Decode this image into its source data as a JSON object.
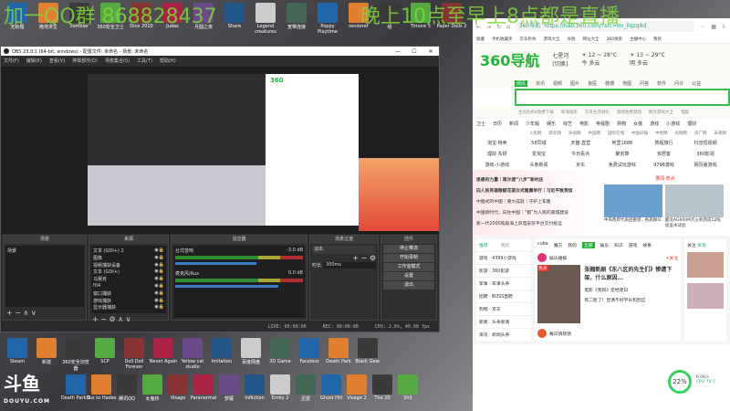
{
  "overlay": {
    "left": "加一QQ群 868828437",
    "right": "晚上10点至早上8点都是直播"
  },
  "desktop_top": [
    "无标题",
    "绝地求生",
    "zombier",
    "360安全卫士",
    "Dice 2010",
    "Judas",
    "月圆之夜",
    "Share",
    "Legend creatures",
    "宽带连接",
    "Poppy Playtime",
    "renderer",
    "组",
    "Timore 5",
    "Paper Dolls 2"
  ],
  "desktop_bottom1": [
    "Steam",
    "新建",
    "360安全浏览器",
    "SCP",
    "Doll Doll Forever",
    "Never Again",
    "Yellow cat studio",
    "Imitation",
    "百度网盘",
    "3D Game",
    "Faceless",
    "Death Park",
    "Black Gear"
  ],
  "desktop_bottom2": [
    "Death Park 2",
    "Bus to Hades",
    "腾讯QQ",
    "女鬼桥",
    "Visage",
    "Paranormal",
    "梦魇",
    "Infliction",
    "Emily 2",
    "迅雷",
    "Ghost Hill",
    "Visage 2",
    "The 20",
    "Sh5"
  ],
  "obs": {
    "title": "OBS 23.0.1 (64-bit, windows) - 配置文件: 未命名 - 场景: 未命名",
    "menu": [
      "文件(F)",
      "编辑(E)",
      "查看(V)",
      "停靠部件(D)",
      "场景集合(S)",
      "工具(T)",
      "帮助(H)"
    ],
    "docks": {
      "scenes": "场景",
      "sources": "来源",
      "mixer": "混音器",
      "transitions": "场景过渡",
      "controls": "控件"
    },
    "scenes": [
      "场景"
    ],
    "sources": [
      "文本 (GDI+) 2",
      "图像",
      "视频捕获设备",
      "文本 (GDI+)",
      "马赛克",
      "f04",
      "窗口捕获",
      "游戏捕获",
      "显示器捕获"
    ],
    "mixer": [
      {
        "name": "台式音响",
        "db": "-3.0 dB",
        "level": 0.75
      },
      {
        "name": "麦克风/Aux",
        "db": "0.0 dB",
        "level": 0.95
      }
    ],
    "transition": {
      "type": "淡出",
      "duration_label": "时长",
      "duration": "300ms"
    },
    "controls": [
      "停止推流",
      "开始录制",
      "工作室模式",
      "设置",
      "退出"
    ],
    "status": {
      "live": "LIVE: 00:00:00",
      "rec": "REC: 00:00:00",
      "cpu": "CPU: 2.6%, 40.00 fps"
    }
  },
  "browser": {
    "url": "https://hao.360.com/?src=lm_llqzq8d",
    "site_tag": "360导航",
    "bookmarks": [
      "收藏",
      "手机收藏夹",
      "京东秒杀",
      "游戏大全",
      "谷歌",
      "网址大全",
      "360搜索",
      "主播中心",
      "我的"
    ],
    "logo": "360导航",
    "city": "七星河",
    "city_sub": "[切换]",
    "weather": [
      {
        "temp": "12 ~ 28°C",
        "day": "今",
        "desc": "多云"
      },
      {
        "temp": "13 ~ 29°C",
        "day": "明",
        "desc": "多云"
      }
    ],
    "search_tabs": [
      "网页",
      "资讯",
      "视频",
      "图片",
      "良医",
      "微博",
      "地图",
      "问答",
      "软件",
      "问诊",
      "公益"
    ],
    "hot": [
      "生化危机4免费下载",
      "探海迷航",
      "方舟生存进化",
      "游戏免费游戏",
      "网页游戏大全",
      "电脑"
    ],
    "nav": [
      "卫士",
      "日历",
      "新闻",
      "少年版",
      "娱乐",
      "综艺",
      "电影",
      "电视剧",
      "购物",
      "女装",
      "游戏",
      "小游戏",
      "理财"
    ],
    "media": [
      "人民网",
      "新华网",
      "央视网",
      "中国网",
      "国际在线",
      "中国日报",
      "中经网",
      "光明网",
      "央广网",
      "未来网"
    ],
    "sites": [
      "淘宝·特卖",
      "58同城",
      "天猫·直营",
      "阿里1688",
      "携程旅行",
      "抖音短视频",
      "理财·东财",
      "爱淘宝",
      "今日看点",
      "聚划算",
      "安居客",
      "360影视",
      "游戏·小游戏",
      "头条新闻",
      "京东",
      "免费试玩游戏",
      "9798游戏",
      "网页版游戏"
    ],
    "news": [
      "思想的力量｜南沙渡“八步”新村庄",
      "向人民英雄敬献花篮仪式隆重举行｜习近平致贺信",
      "中国式的中国｜重大成就｜守护上军路",
      "中国新时代、向往中国｜“都”为人民的美城建设",
      "新一代2000吨级海上风电安装平台交付投运"
    ],
    "hot_title": "要闻·热点",
    "pics": [
      "中央政府代表团看望...各族群众",
      "鲲龙AG600M灭火机完成12吨投汲水试验"
    ],
    "left_tabs": [
      "推荐",
      "我的"
    ],
    "left_list": [
      "游戏 · 4399小游戏",
      "影游 · 360影游",
      "军事 · 军事头条",
      "招聘 · BOSS直聘",
      "购物 · 京东",
      "新闻 · 头条新闻",
      "资讯 · 新闻头条"
    ],
    "feed_tabs": [
      "cube",
      "魔方",
      "我的",
      "全部",
      "娱乐",
      "知识",
      "游戏",
      "故事"
    ],
    "feed": {
      "author": "娱乐播报",
      "follow": "+关注",
      "headline": "张翰新剧《东八区的先生们》惨遭下架，什么原因...",
      "tag": "热点",
      "b1": "电影《我和》定档夏日",
      "b2": "有二胎了！曾演不好学长和回应",
      "author2": "每日猜猜猜"
    },
    "right_tabs": [
      "关注",
      "发现"
    ],
    "gauge": "22%",
    "cpu": "CPU 76°C",
    "net": "0.0K/s"
  },
  "douyu": {
    "name": "斗鱼",
    "url": "DOUYU.COM"
  }
}
